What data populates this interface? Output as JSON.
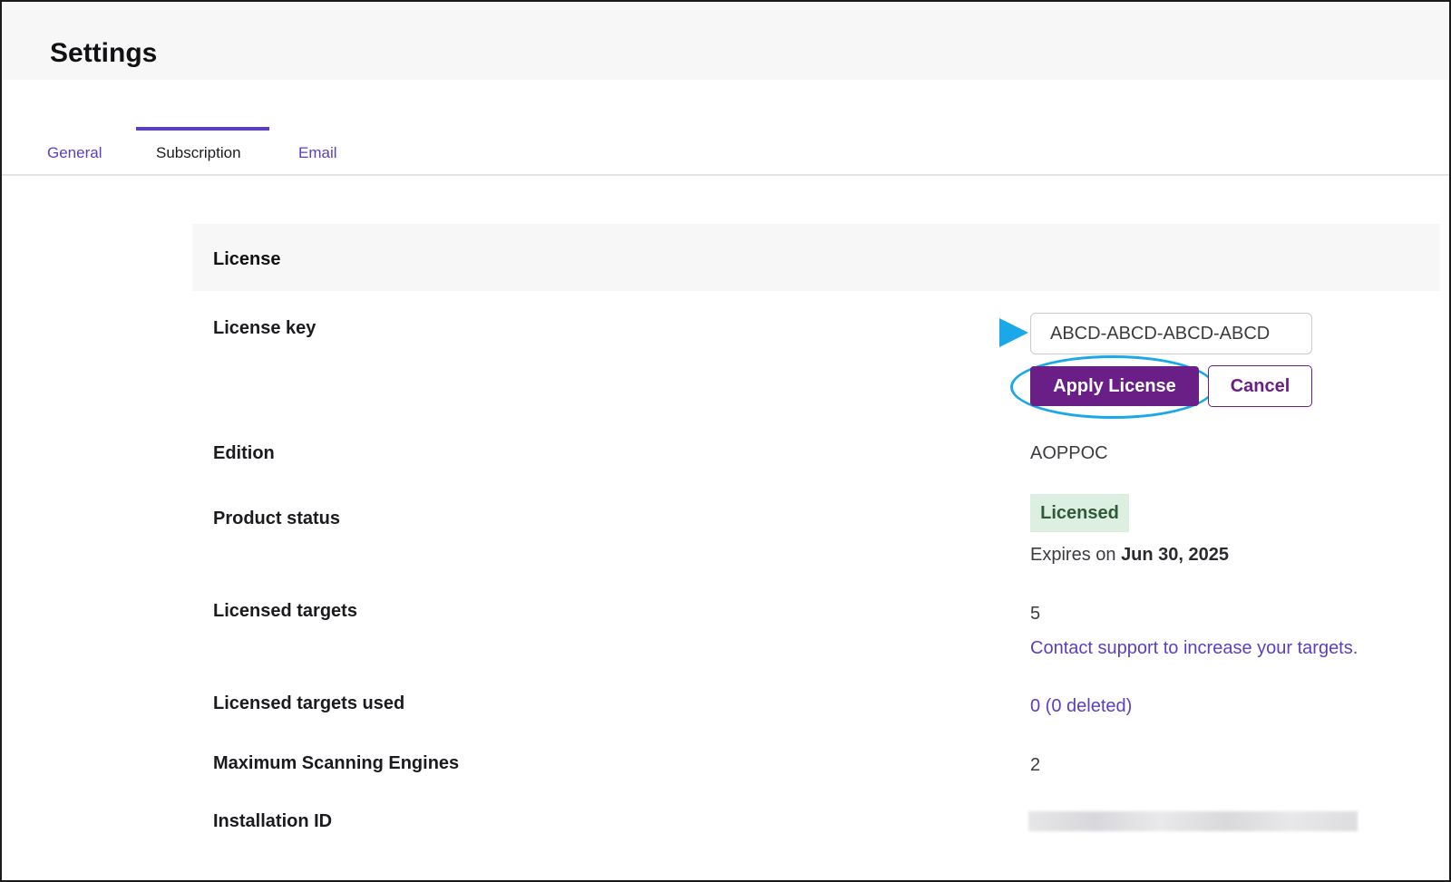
{
  "page": {
    "title": "Settings"
  },
  "tabs": [
    {
      "label": "General",
      "active": false
    },
    {
      "label": "Subscription",
      "active": true
    },
    {
      "label": "Email",
      "active": false
    }
  ],
  "license": {
    "section_title": "License",
    "rows": {
      "license_key": {
        "label": "License key",
        "value": "ABCD-ABCD-ABCD-ABCD"
      },
      "edition": {
        "label": "Edition",
        "value": "AOPPOC"
      },
      "product_status": {
        "label": "Product status",
        "badge": "Licensed",
        "expires_prefix": "Expires on",
        "expires_date": "Jun 30, 2025"
      },
      "licensed_targets": {
        "label": "Licensed targets",
        "value": "5",
        "support_link": "Contact support to increase your targets."
      },
      "licensed_targets_used": {
        "label": "Licensed targets used",
        "value": "0 (0 deleted)"
      },
      "max_engines": {
        "label": "Maximum Scanning Engines",
        "value": "2"
      },
      "installation_id": {
        "label": "Installation ID"
      }
    },
    "buttons": {
      "apply": "Apply License",
      "cancel": "Cancel"
    }
  },
  "colors": {
    "accent": "#5b3fc0",
    "primary_button": "#6a1f86",
    "annotation": "#1aa8e8",
    "badge_bg": "#dcefe0",
    "badge_text": "#2f5a3a"
  }
}
